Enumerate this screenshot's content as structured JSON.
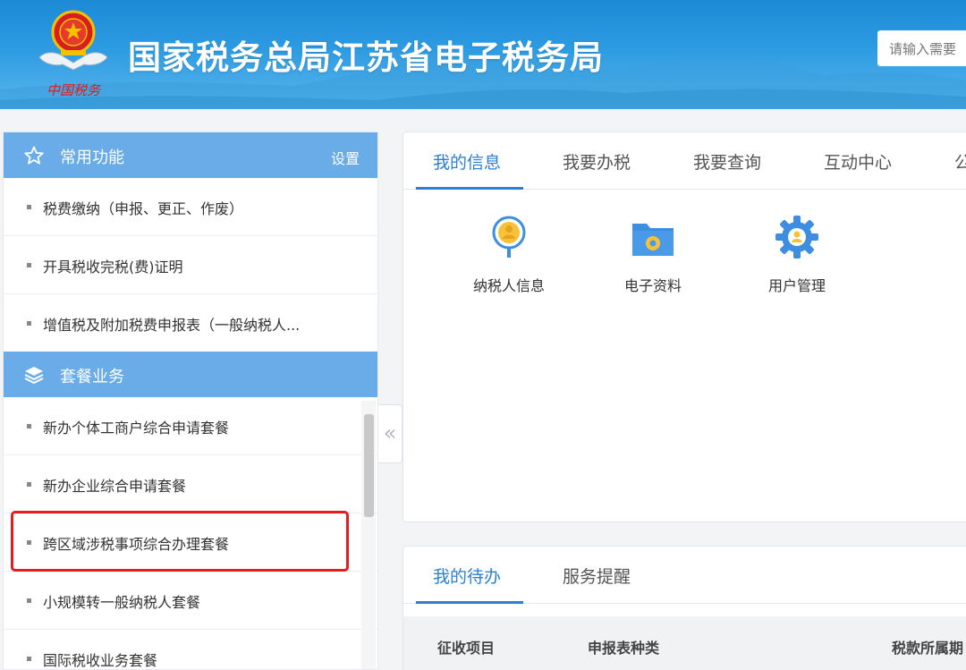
{
  "header": {
    "site_title": "国家税务总局江苏省电子税务局",
    "emblem_caption": "中国税务",
    "search_placeholder": "请输入需要"
  },
  "sidebar": {
    "common": {
      "title": "常用功能",
      "setting_label": "设置",
      "items": [
        {
          "label": "税费缴纳（申报、更正、作废）"
        },
        {
          "label": "开具税收完税(费)证明"
        },
        {
          "label": "增值税及附加税费申报表（一般纳税人..."
        }
      ]
    },
    "packages": {
      "title": "套餐业务",
      "items": [
        {
          "label": "新办个体工商户综合申请套餐"
        },
        {
          "label": "新办企业综合申请套餐"
        },
        {
          "label": "跨区域涉税事项综合办理套餐"
        },
        {
          "label": "小规模转一般纳税人套餐"
        },
        {
          "label": "国际税收业务套餐"
        }
      ]
    },
    "collapse_glyph": "«"
  },
  "info_panel": {
    "tabs": [
      {
        "label": "我的信息",
        "active": true
      },
      {
        "label": "我要办税"
      },
      {
        "label": "我要查询"
      },
      {
        "label": "互动中心"
      },
      {
        "label": "公"
      }
    ],
    "tiles": [
      {
        "label": "纳税人信息",
        "icon": "taxpayer-info-icon"
      },
      {
        "label": "电子资料",
        "icon": "folder-icon"
      },
      {
        "label": "用户管理",
        "icon": "gear-icon"
      }
    ]
  },
  "todo_panel": {
    "tabs": [
      {
        "label": "我的待办",
        "active": true
      },
      {
        "label": "服务提醒"
      }
    ],
    "columns": [
      "征收项目",
      "申报表种类",
      "税款所属期"
    ]
  },
  "colors": {
    "header_blue": "#1d8ad6",
    "sidebar_head": "#6aace8",
    "accent_blue": "#2b7fd4",
    "highlight_red": "#e51c1c"
  }
}
